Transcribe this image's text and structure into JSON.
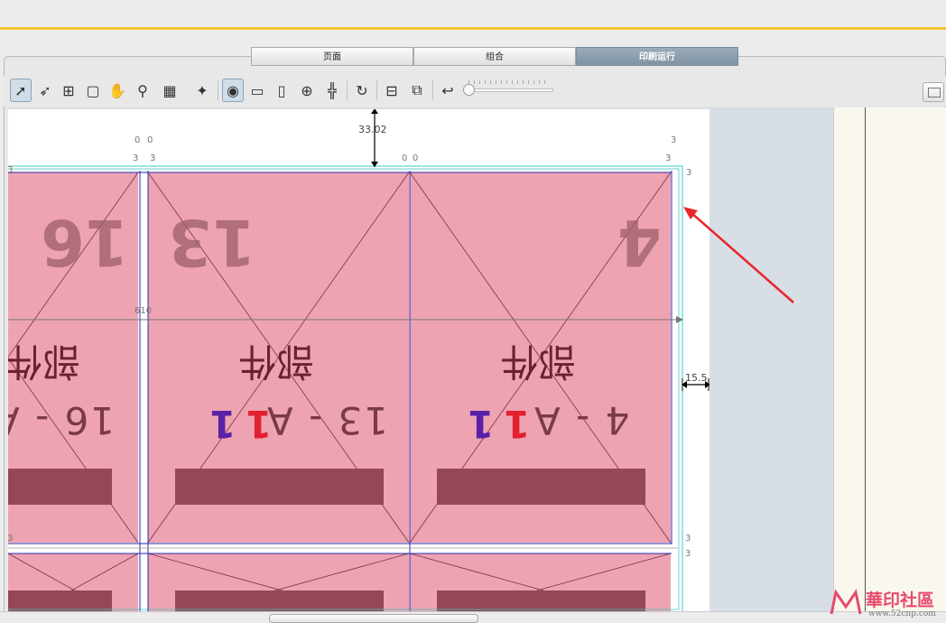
{
  "tabs": [
    {
      "label": "页面",
      "active": false
    },
    {
      "label": "组合",
      "active": false
    },
    {
      "label": "印刷运行",
      "active": true
    }
  ],
  "toolbar": {
    "buttons": [
      {
        "name": "select-arrow-icon",
        "glyph": "➚",
        "selected": true
      },
      {
        "name": "pointer-icon",
        "glyph": "➶",
        "selected": false
      },
      {
        "name": "page-tool-icon",
        "glyph": "⊞",
        "selected": false
      },
      {
        "name": "sheet-tool-icon",
        "glyph": "▢",
        "selected": false
      },
      {
        "name": "hand-icon",
        "glyph": "✋",
        "selected": false
      },
      {
        "name": "zoom-icon",
        "glyph": "⚲",
        "selected": false
      },
      {
        "name": "layout-grid-icon",
        "glyph": "▦",
        "selected": false
      },
      {
        "name": "magic-icon",
        "glyph": "✦",
        "selected": false
      },
      {
        "name": "view-eye-icon",
        "glyph": "◉",
        "selected": true
      },
      {
        "name": "ruler-icon",
        "glyph": "▭",
        "selected": false
      },
      {
        "name": "document-icon",
        "glyph": "▯",
        "selected": false
      },
      {
        "name": "crosshair-icon",
        "glyph": "⊕",
        "selected": false
      },
      {
        "name": "align-icon",
        "glyph": "╬",
        "selected": false
      },
      {
        "name": "rotate-icon",
        "glyph": "↻",
        "selected": false
      },
      {
        "name": "imposition-icon",
        "glyph": "⊟",
        "selected": false
      },
      {
        "name": "swap-layout-icon",
        "glyph": "⧉",
        "selected": false
      },
      {
        "name": "return-icon",
        "glyph": "↩",
        "selected": false
      }
    ],
    "zoom_slider": 0.0
  },
  "sheet": {
    "top_margin_dim": "33.02",
    "side_dim": "15.5",
    "center_dim": "610",
    "tick_values": [
      "0",
      "0",
      "3",
      "3",
      "3",
      "3",
      "3",
      "0",
      "0",
      "3",
      "3",
      "3",
      "3"
    ]
  },
  "pages": [
    {
      "number": "16",
      "part": "部件",
      "code": "16 - A"
    },
    {
      "number": "13",
      "part": "部件",
      "code": "13 - A",
      "mark1": "1",
      "mark2": "1"
    },
    {
      "number": "4",
      "part": "部件",
      "code": "4 - A",
      "mark1": "1",
      "mark2": "1"
    }
  ],
  "watermark": {
    "title": "華印社區",
    "url": "www.52cnp.com"
  },
  "colors": {
    "accent": "#f2c530",
    "page_fill": "#eea3b2",
    "bar": "#954757",
    "active_tab": "#8a9eae"
  }
}
